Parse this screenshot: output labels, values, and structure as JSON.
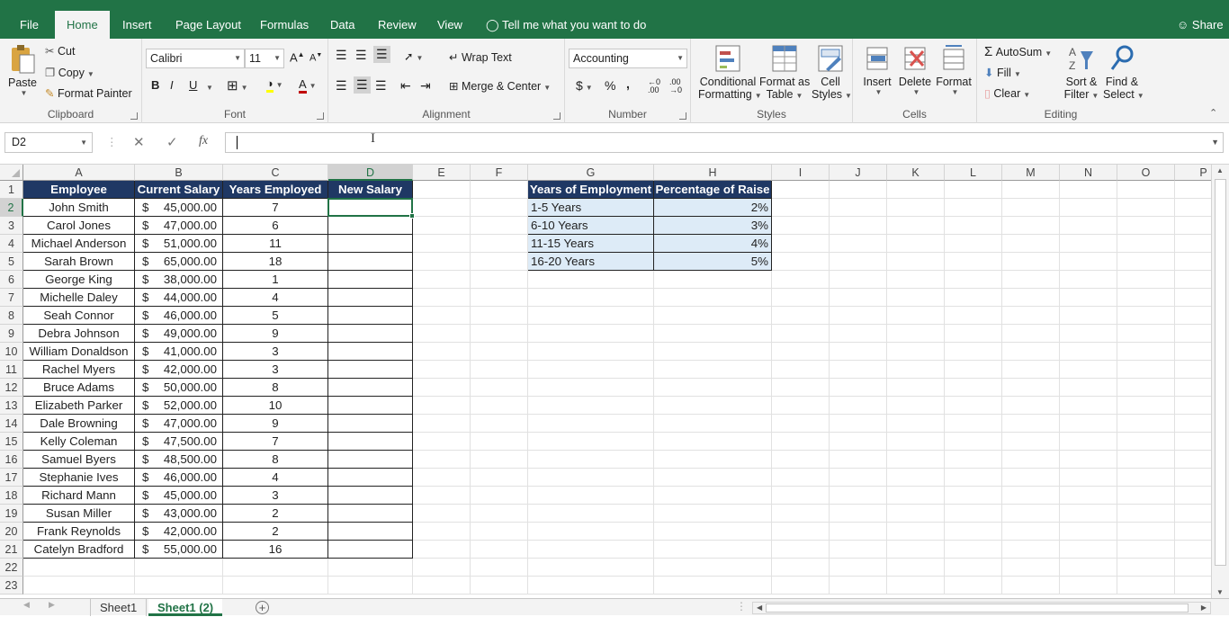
{
  "ribbon_tabs": [
    "File",
    "Home",
    "Insert",
    "Page Layout",
    "Formulas",
    "Data",
    "Review",
    "View"
  ],
  "tell_me": "Tell me what you want to do",
  "share": "Share",
  "clipboard": {
    "paste": "Paste",
    "cut": "Cut",
    "copy": "Copy",
    "format_painter": "Format Painter",
    "label": "Clipboard"
  },
  "font": {
    "name": "Calibri",
    "size": "11",
    "bold": "B",
    "italic": "I",
    "underline": "U",
    "label": "Font"
  },
  "alignment": {
    "wrap": "Wrap Text",
    "merge": "Merge & Center",
    "label": "Alignment"
  },
  "number": {
    "format": "Accounting",
    "currency": "$",
    "percent": "%",
    "comma": ",",
    "label": "Number"
  },
  "styles": {
    "conditional": "Conditional",
    "formatting": "Formatting",
    "format_as": "Format as",
    "table": "Table",
    "cell": "Cell",
    "cell_styles": "Styles",
    "label": "Styles"
  },
  "cells": {
    "insert": "Insert",
    "delete": "Delete",
    "format": "Format",
    "label": "Cells"
  },
  "editing": {
    "autosum": "AutoSum",
    "fill": "Fill",
    "clear": "Clear",
    "sort1": "Sort &",
    "sort2": "Filter",
    "find1": "Find &",
    "find2": "Select",
    "label": "Editing"
  },
  "formula_bar": {
    "name_box": "D2",
    "fx": "fx",
    "formula": ""
  },
  "columns": [
    "A",
    "B",
    "C",
    "D",
    "E",
    "F",
    "G",
    "H",
    "I",
    "J",
    "K",
    "L",
    "M",
    "N",
    "O",
    "P"
  ],
  "rows": [
    "1",
    "2",
    "3",
    "4",
    "5",
    "6",
    "7",
    "8",
    "9",
    "10",
    "11",
    "12",
    "13",
    "14",
    "15",
    "16",
    "17",
    "18",
    "19",
    "20",
    "21",
    "22",
    "23"
  ],
  "table_headers": [
    "Employee",
    "Current Salary",
    "Years Employed",
    "New Salary"
  ],
  "employees": [
    {
      "name": "John Smith",
      "salary": "45,000.00",
      "years": "7"
    },
    {
      "name": "Carol Jones",
      "salary": "47,000.00",
      "years": "6"
    },
    {
      "name": "Michael Anderson",
      "salary": "51,000.00",
      "years": "11"
    },
    {
      "name": "Sarah Brown",
      "salary": "65,000.00",
      "years": "18"
    },
    {
      "name": "George King",
      "salary": "38,000.00",
      "years": "1"
    },
    {
      "name": "Michelle Daley",
      "salary": "44,000.00",
      "years": "4"
    },
    {
      "name": "Seah Connor",
      "salary": "46,000.00",
      "years": "5"
    },
    {
      "name": "Debra Johnson",
      "salary": "49,000.00",
      "years": "9"
    },
    {
      "name": "William Donaldson",
      "salary": "41,000.00",
      "years": "3"
    },
    {
      "name": "Rachel Myers",
      "salary": "42,000.00",
      "years": "3"
    },
    {
      "name": "Bruce Adams",
      "salary": "50,000.00",
      "years": "8"
    },
    {
      "name": "Elizabeth Parker",
      "salary": "52,000.00",
      "years": "10"
    },
    {
      "name": "Dale Browning",
      "salary": "47,000.00",
      "years": "9"
    },
    {
      "name": "Kelly Coleman",
      "salary": "47,500.00",
      "years": "7"
    },
    {
      "name": "Samuel Byers",
      "salary": "48,500.00",
      "years": "8"
    },
    {
      "name": "Stephanie Ives",
      "salary": "46,000.00",
      "years": "4"
    },
    {
      "name": "Richard Mann",
      "salary": "45,000.00",
      "years": "3"
    },
    {
      "name": "Susan Miller",
      "salary": "43,000.00",
      "years": "2"
    },
    {
      "name": "Frank Reynolds",
      "salary": "42,000.00",
      "years": "2"
    },
    {
      "name": "Catelyn Bradford",
      "salary": "55,000.00",
      "years": "16"
    }
  ],
  "currency_symbol": "$",
  "raise_headers": [
    "Years of Employment",
    "Percentage of Raise"
  ],
  "raise_table": [
    {
      "range": "1-5 Years",
      "pct": "2%"
    },
    {
      "range": "6-10 Years",
      "pct": "3%"
    },
    {
      "range": "11-15 Years",
      "pct": "4%"
    },
    {
      "range": "16-20 Years",
      "pct": "5%"
    }
  ],
  "sheets": [
    "Sheet1",
    "Sheet1 (2)"
  ],
  "active_cell": "D2",
  "colors": {
    "excel_green": "#217346",
    "header_navy": "#1f3864",
    "light_blue": "#ddebf7"
  }
}
